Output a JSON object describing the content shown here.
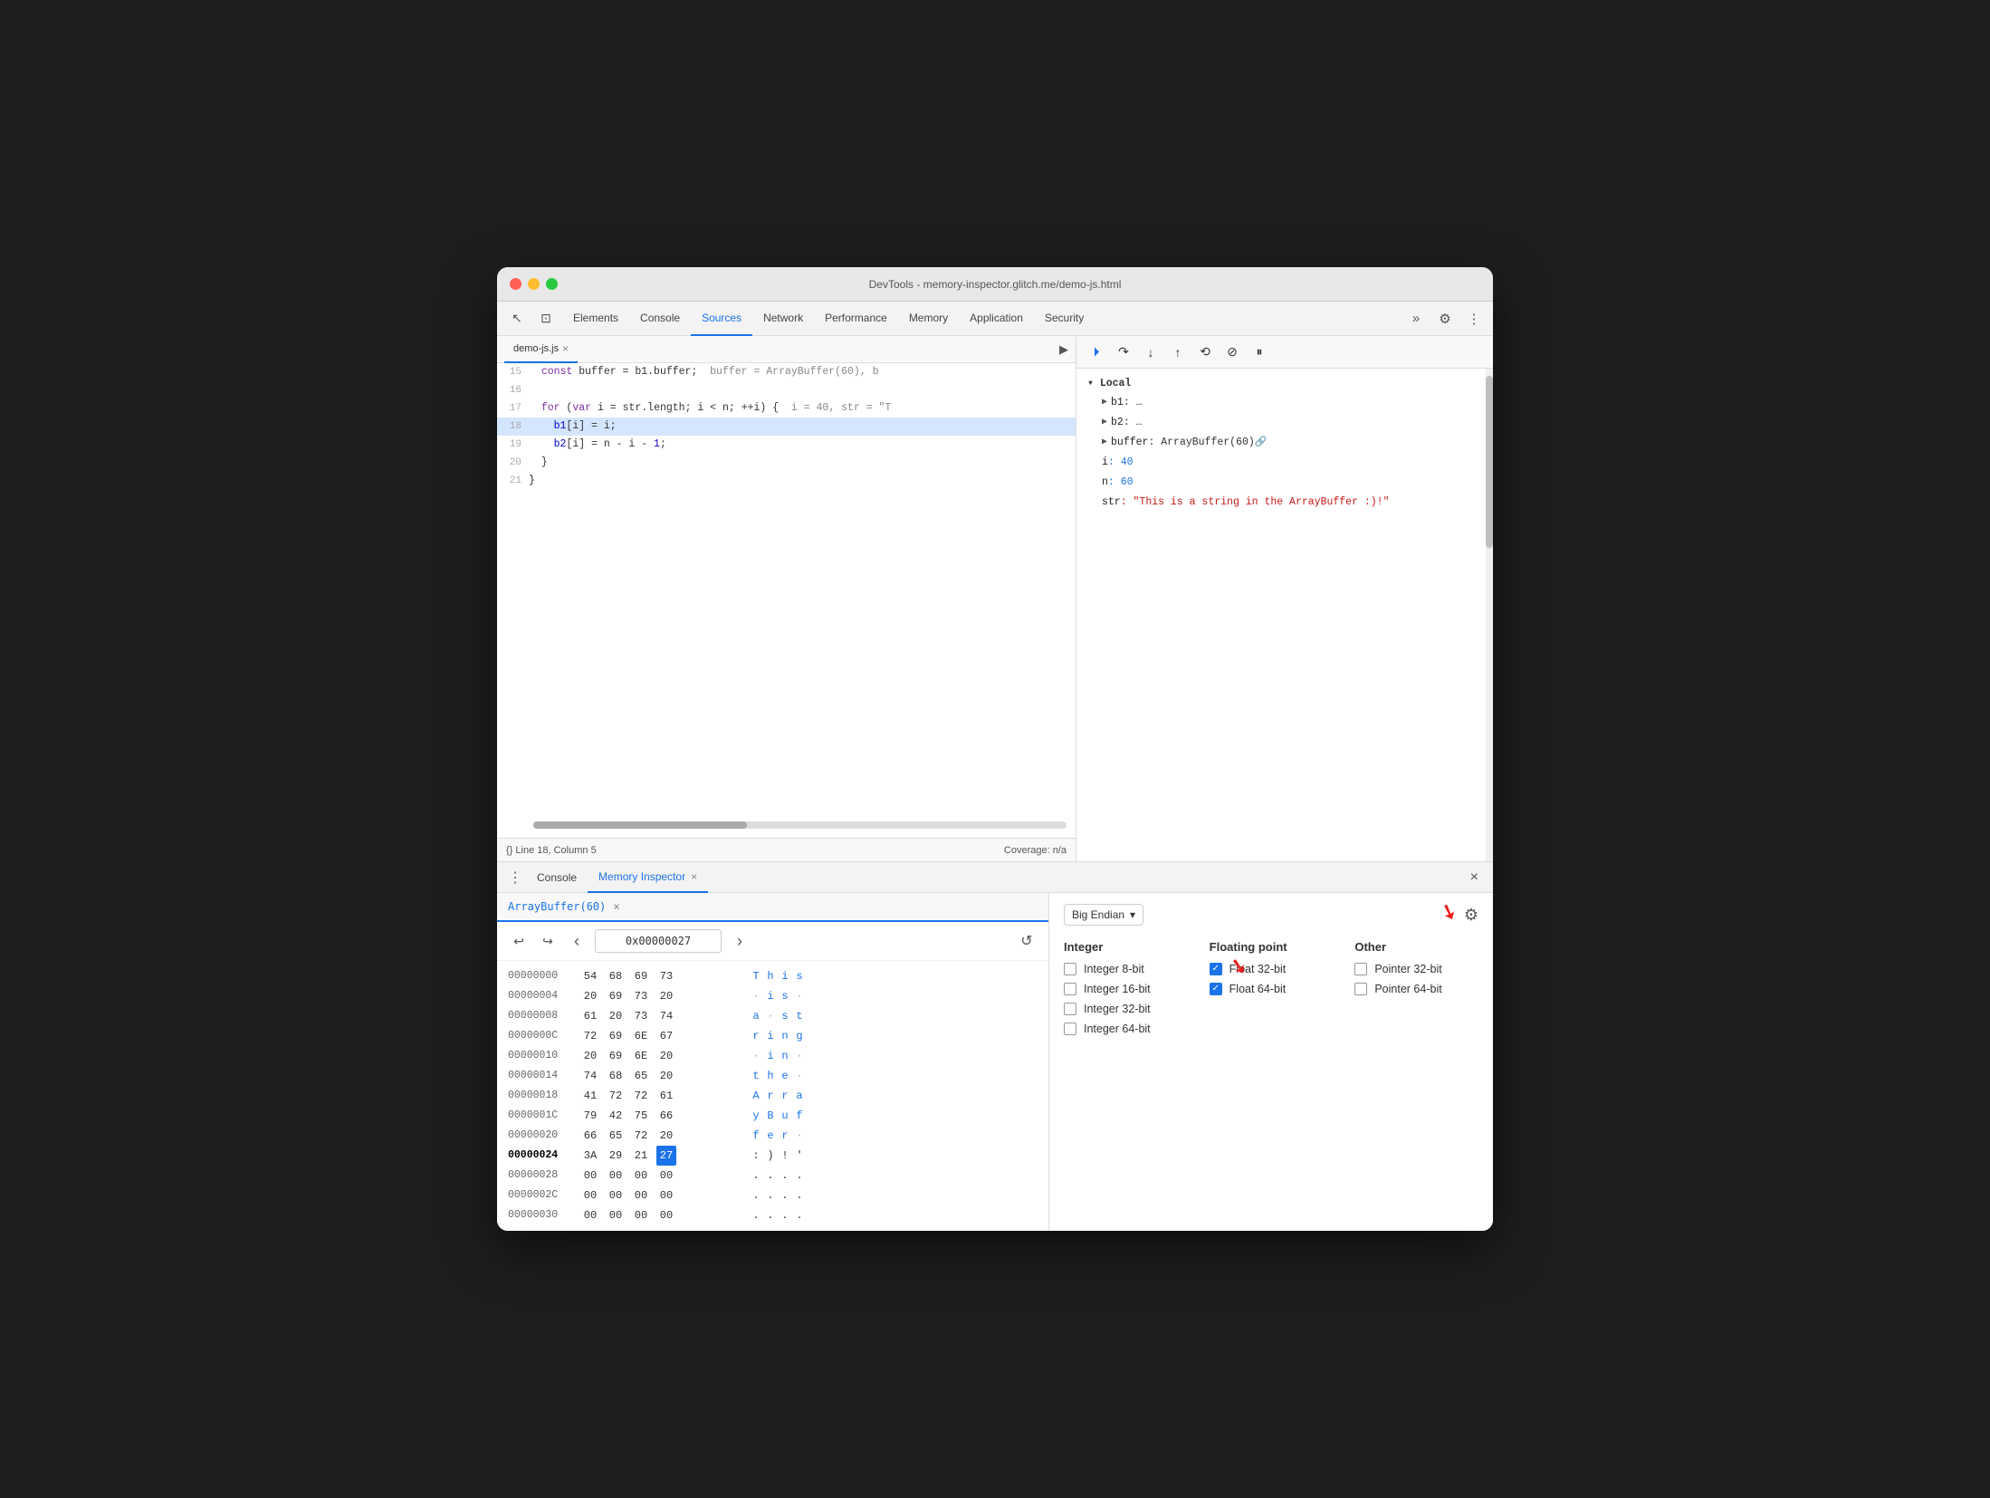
{
  "window": {
    "title": "DevTools - memory-inspector.glitch.me/demo-js.html"
  },
  "tabs": {
    "items": [
      "Elements",
      "Console",
      "Sources",
      "Network",
      "Performance",
      "Memory",
      "Application",
      "Security"
    ],
    "active": "Sources",
    "more_label": "»"
  },
  "source_file": {
    "name": "demo-js.js",
    "run_icon": "▶"
  },
  "debug_toolbar": {
    "resume": "⏵",
    "step_over": "↷",
    "step_into": "↓",
    "step_out": "↑",
    "step_back": "⟲",
    "deactivate": "⊘",
    "pause": "⏸"
  },
  "code": {
    "lines": [
      {
        "num": "15",
        "content": "  const buffer = b1.buffer;  buffer = ArrayBuffer(60), b",
        "highlight": false
      },
      {
        "num": "16",
        "content": "",
        "highlight": false
      },
      {
        "num": "17",
        "content": "  for (var i = str.length; i < n; ++i) {  i = 40, str = \"T",
        "highlight": false
      },
      {
        "num": "18",
        "content": "    b1[i] = i;",
        "highlight": true
      },
      {
        "num": "19",
        "content": "    b2[i] = n - i - 1;",
        "highlight": false
      },
      {
        "num": "20",
        "content": "  }",
        "highlight": false
      },
      {
        "num": "21",
        "content": "}",
        "highlight": false
      }
    ]
  },
  "status_bar": {
    "left": "{}  Line 18, Column 5",
    "right": "Coverage: n/a"
  },
  "debugger": {
    "section_label": "▾ Local",
    "vars": [
      {
        "name": "▶ b1",
        "value": ": …"
      },
      {
        "name": "▶ b2",
        "value": ": …"
      },
      {
        "name": "▶ buffer",
        "value": ": ArrayBuffer(60) 🔗"
      },
      {
        "name": "i",
        "value": ": 40"
      },
      {
        "name": "n",
        "value": ": 60"
      },
      {
        "name": "str",
        "value": ": \"This is a string in the ArrayBuffer :)!\""
      }
    ]
  },
  "bottom_tabs": {
    "console_label": "Console",
    "memory_inspector_label": "Memory Inspector",
    "close_icon": "×"
  },
  "memory_inspector": {
    "file_tab_label": "ArrayBuffer(60)",
    "address": "0x00000027",
    "endian_label": "Big Endian",
    "rows": [
      {
        "addr": "00000000",
        "bytes": [
          "54",
          "68",
          "69",
          "73"
        ],
        "chars": [
          "T",
          "h",
          "i",
          "s"
        ],
        "bold": false
      },
      {
        "addr": "00000004",
        "bytes": [
          "20",
          "69",
          "73",
          "20"
        ],
        "chars": [
          " ",
          "i",
          "s",
          " "
        ],
        "bold": false
      },
      {
        "addr": "00000008",
        "bytes": [
          "61",
          "20",
          "73",
          "74"
        ],
        "chars": [
          "a",
          " ",
          "s",
          "t"
        ],
        "bold": false
      },
      {
        "addr": "0000000C",
        "bytes": [
          "72",
          "69",
          "6E",
          "67"
        ],
        "chars": [
          "r",
          "i",
          "n",
          "g"
        ],
        "bold": false
      },
      {
        "addr": "00000010",
        "bytes": [
          "20",
          "69",
          "6E",
          "20"
        ],
        "chars": [
          " ",
          "i",
          "n",
          " "
        ],
        "bold": false
      },
      {
        "addr": "00000014",
        "bytes": [
          "74",
          "68",
          "65",
          "20"
        ],
        "chars": [
          "t",
          "h",
          "e",
          " "
        ],
        "bold": false
      },
      {
        "addr": "00000018",
        "bytes": [
          "41",
          "72",
          "72",
          "61"
        ],
        "chars": [
          "A",
          "r",
          "r",
          "a"
        ],
        "bold": false
      },
      {
        "addr": "0000001C",
        "bytes": [
          "79",
          "42",
          "75",
          "66"
        ],
        "chars": [
          "y",
          "B",
          "u",
          "f"
        ],
        "bold": false
      },
      {
        "addr": "00000020",
        "bytes": [
          "66",
          "65",
          "72",
          "20"
        ],
        "chars": [
          "f",
          "e",
          "r",
          " "
        ],
        "bold": false
      },
      {
        "addr": "00000024",
        "bytes": [
          "3A",
          "29",
          "21",
          "27"
        ],
        "chars": [
          ":",
          " )",
          "!",
          "'"
        ],
        "bold": true,
        "highlight_byte": 3
      },
      {
        "addr": "00000028",
        "bytes": [
          "00",
          "00",
          "00",
          "00"
        ],
        "chars": [
          ".",
          ".",
          ".",
          "."
        ],
        "bold": false
      },
      {
        "addr": "0000002C",
        "bytes": [
          "00",
          "00",
          "00",
          "00"
        ],
        "chars": [
          ".",
          ".",
          ".",
          "."
        ],
        "bold": false
      },
      {
        "addr": "00000030",
        "bytes": [
          "00",
          "00",
          "00",
          "00"
        ],
        "chars": [
          ".",
          ".",
          ".",
          "."
        ],
        "bold": false
      }
    ],
    "type_sections": {
      "integer": {
        "label": "Integer",
        "items": [
          {
            "label": "Integer 8-bit",
            "checked": false
          },
          {
            "label": "Integer 16-bit",
            "checked": false
          },
          {
            "label": "Integer 32-bit",
            "checked": false
          },
          {
            "label": "Integer 64-bit",
            "checked": false
          }
        ]
      },
      "floating": {
        "label": "Floating point",
        "items": [
          {
            "label": "Float 32-bit",
            "checked": true
          },
          {
            "label": "Float 64-bit",
            "checked": true
          }
        ]
      },
      "other": {
        "label": "Other",
        "items": [
          {
            "label": "Pointer 32-bit",
            "checked": false
          },
          {
            "label": "Pointer 64-bit",
            "checked": false
          }
        ]
      }
    }
  }
}
